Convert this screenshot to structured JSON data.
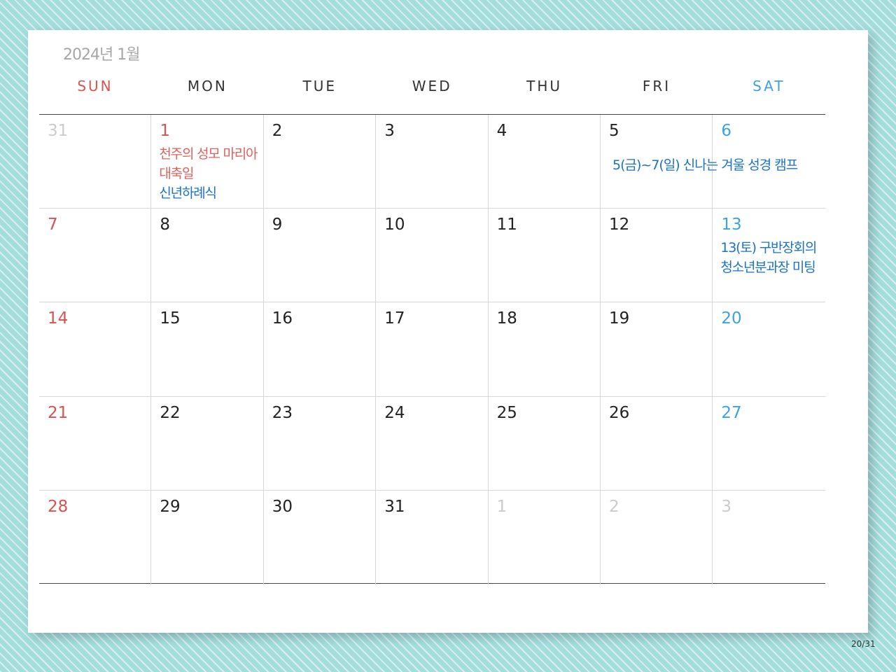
{
  "calendar": {
    "title": "2024년 1월",
    "weekdays": [
      {
        "label": "SUN",
        "color": "#d9534f"
      },
      {
        "label": "MON",
        "color": "#333333"
      },
      {
        "label": "TUE",
        "color": "#333333"
      },
      {
        "label": "WED",
        "color": "#333333"
      },
      {
        "label": "THU",
        "color": "#333333"
      },
      {
        "label": "FRI",
        "color": "#333333"
      },
      {
        "label": "SAT",
        "color": "#3ba3e0"
      }
    ],
    "colors": {
      "sunday": "#d9534f",
      "saturday": "#3ba3e0",
      "weekday": "#222222",
      "other_month": "#cccccc",
      "event_red": "#e0615c",
      "event_blue": "#1a73c9"
    },
    "weeks": [
      [
        {
          "day": "31",
          "kind": "other"
        },
        {
          "day": "1",
          "kind": "holiday",
          "events": [
            {
              "text": "천주의 성모 마리아",
              "tone": "red"
            },
            {
              "text": "대축일",
              "tone": "red"
            },
            {
              "text": "신년하례식",
              "tone": "blue"
            }
          ]
        },
        {
          "day": "2",
          "kind": "weekday"
        },
        {
          "day": "3",
          "kind": "weekday"
        },
        {
          "day": "4",
          "kind": "weekday"
        },
        {
          "day": "5",
          "kind": "weekday"
        },
        {
          "day": "6",
          "kind": "sat"
        }
      ],
      [
        {
          "day": "7",
          "kind": "sun"
        },
        {
          "day": "8",
          "kind": "weekday"
        },
        {
          "day": "9",
          "kind": "weekday"
        },
        {
          "day": "10",
          "kind": "weekday"
        },
        {
          "day": "11",
          "kind": "weekday"
        },
        {
          "day": "12",
          "kind": "weekday"
        },
        {
          "day": "13",
          "kind": "sat",
          "events": [
            {
              "text": "13(토) 구반장회의",
              "tone": "blue"
            },
            {
              "text": "청소년분과장 미팅",
              "tone": "blue"
            }
          ]
        }
      ],
      [
        {
          "day": "14",
          "kind": "sun"
        },
        {
          "day": "15",
          "kind": "weekday"
        },
        {
          "day": "16",
          "kind": "weekday"
        },
        {
          "day": "17",
          "kind": "weekday"
        },
        {
          "day": "18",
          "kind": "weekday"
        },
        {
          "day": "19",
          "kind": "weekday"
        },
        {
          "day": "20",
          "kind": "sat"
        }
      ],
      [
        {
          "day": "21",
          "kind": "sun"
        },
        {
          "day": "22",
          "kind": "weekday"
        },
        {
          "day": "23",
          "kind": "weekday"
        },
        {
          "day": "24",
          "kind": "weekday"
        },
        {
          "day": "25",
          "kind": "weekday"
        },
        {
          "day": "26",
          "kind": "weekday"
        },
        {
          "day": "27",
          "kind": "sat"
        }
      ],
      [
        {
          "day": "28",
          "kind": "sun"
        },
        {
          "day": "29",
          "kind": "weekday"
        },
        {
          "day": "30",
          "kind": "weekday"
        },
        {
          "day": "31",
          "kind": "weekday"
        },
        {
          "day": "1",
          "kind": "other"
        },
        {
          "day": "2",
          "kind": "other"
        },
        {
          "day": "3",
          "kind": "other"
        }
      ]
    ],
    "spanning_event": {
      "text": "5(금)~7(일) 신나는 겨울 성경 캠프",
      "tone": "blue"
    }
  },
  "slide": {
    "page_number": "20/31"
  }
}
